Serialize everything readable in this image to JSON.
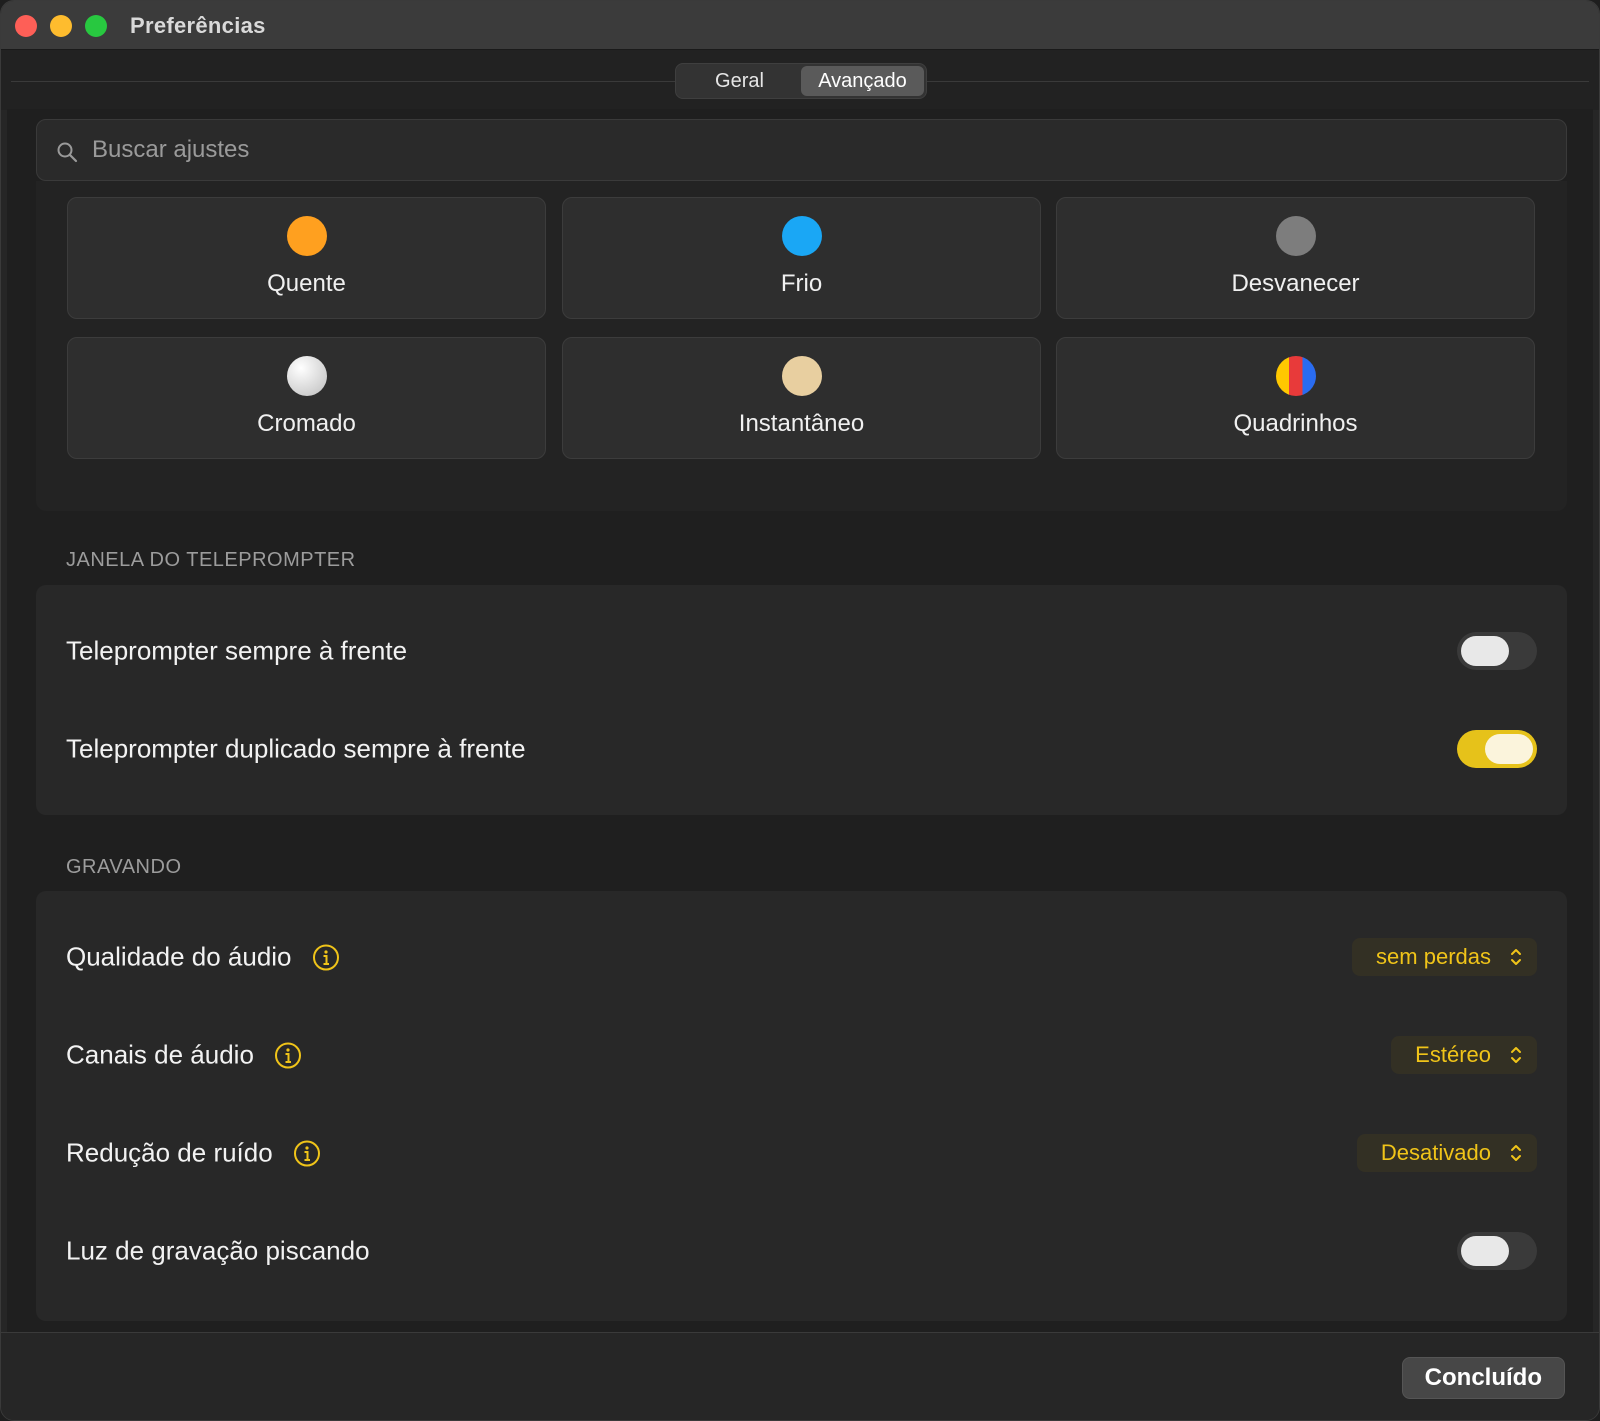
{
  "window": {
    "title": "Preferências"
  },
  "tabs": [
    {
      "label": "Geral",
      "active": false
    },
    {
      "label": "Avançado",
      "active": true
    }
  ],
  "search": {
    "placeholder": "Buscar ajustes",
    "value": "",
    "icon": "search-icon"
  },
  "themes": [
    {
      "label": "Quente",
      "color": "#ffa01f"
    },
    {
      "label": "Frio",
      "color": "#1aa7f5"
    },
    {
      "label": "Desvanecer",
      "color": "#7d7d7d"
    },
    {
      "label": "Cromado",
      "color": "#e4e4e4"
    },
    {
      "label": "Instantâneo",
      "color": "#e8cfa0"
    },
    {
      "label": "Quadrinhos",
      "colors": [
        "#ffc800",
        "#e83a3a",
        "#2a6cf0"
      ]
    }
  ],
  "sections": {
    "teleprompter": {
      "header": "JANELA DO TELEPROMPTER",
      "rows": [
        {
          "label": "Teleprompter sempre à frente",
          "toggle": false
        },
        {
          "label": "Teleprompter duplicado sempre à frente",
          "toggle": true
        }
      ]
    },
    "recording": {
      "header": "GRAVANDO",
      "rows": [
        {
          "label": "Qualidade do áudio",
          "info": true,
          "value": "sem perdas"
        },
        {
          "label": "Canais de áudio",
          "info": true,
          "value": "Estéreo"
        },
        {
          "label": "Redução de ruído",
          "info": true,
          "value": "Desativado"
        },
        {
          "label": "Luz de gravação piscando",
          "toggle": false
        }
      ]
    }
  },
  "footer": {
    "done_label": "Concluído"
  },
  "colors": {
    "accent": "#f0c419",
    "toggle_on": "#e6c21a"
  }
}
